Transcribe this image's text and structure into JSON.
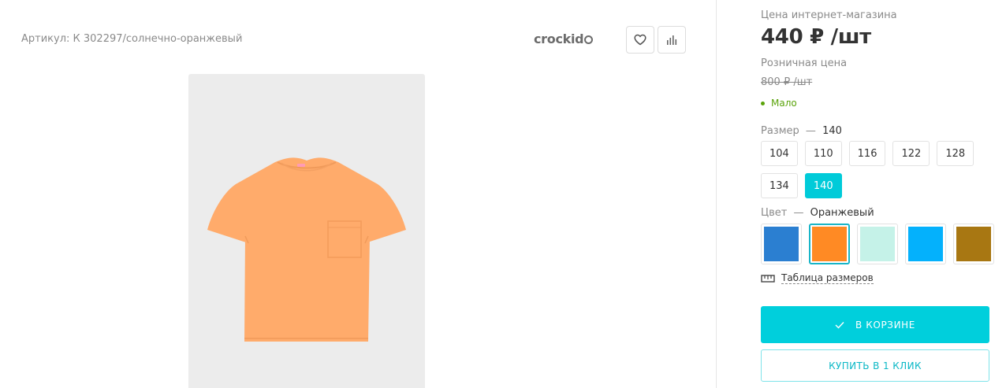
{
  "product": {
    "article": "Артикул: К 302297/солнечно-оранжевый",
    "brand": "crockid",
    "image_bg": "#ececec",
    "garment_color": "#ffab6b"
  },
  "actions": {
    "favorite_icon": "heart-icon",
    "compare_icon": "bar-chart-icon"
  },
  "pricing": {
    "online_label": "Цена интернет-магазина",
    "online_price": "440 ₽ /шт",
    "retail_label": "Розничная цена",
    "retail_price": "800 ₽ /шт",
    "stock": "Мало",
    "stock_color": "#5aa30a"
  },
  "size": {
    "label": "Размер",
    "dash": "—",
    "selected": "140",
    "options": [
      "104",
      "110",
      "116",
      "122",
      "128",
      "134",
      "140"
    ]
  },
  "color": {
    "label": "Цвет",
    "dash": "—",
    "selected": "Оранжевый",
    "swatches": [
      "#2b7fd1",
      "#ff8a24",
      "#c5f2e8",
      "#04b1fc",
      "#a87712"
    ],
    "selected_index": 1
  },
  "size_table": {
    "icon": "ruler-icon",
    "label": "Таблица размеров"
  },
  "buttons": {
    "cart_label": "В КОРЗИНЕ",
    "cart_icon": "check-icon",
    "cart_color": "#00cfdc",
    "buy_one_click": "КУПИТЬ В 1 КЛИК"
  }
}
